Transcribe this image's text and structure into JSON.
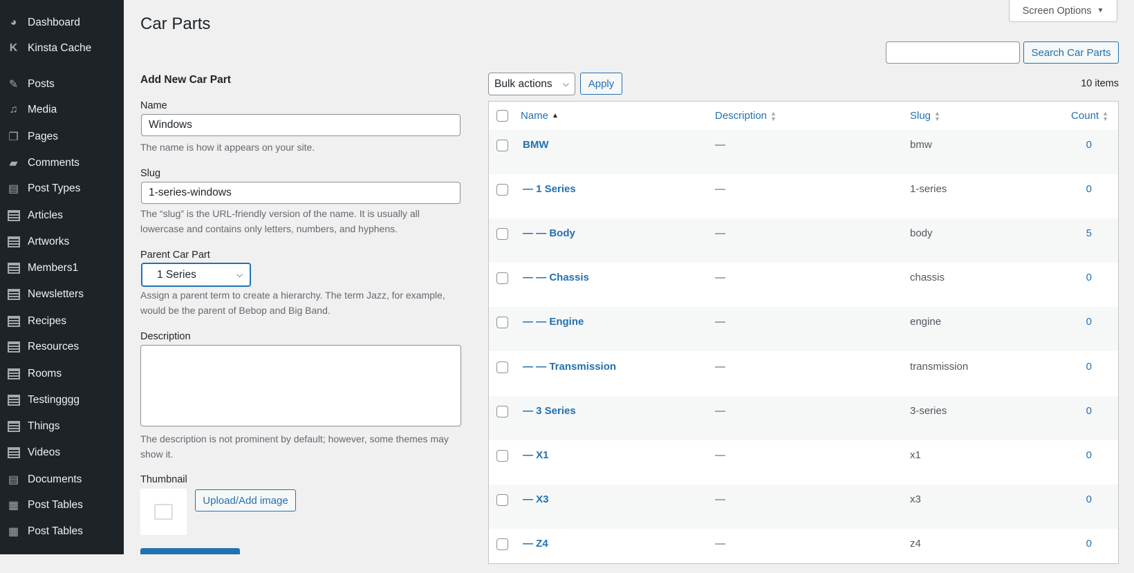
{
  "sidebar": {
    "items": [
      {
        "label": "Dashboard",
        "icon": "dashboard-icon"
      },
      {
        "label": "Kinsta Cache",
        "icon": "kinsta-icon"
      },
      {
        "label": "Posts",
        "icon": "pin-icon"
      },
      {
        "label": "Media",
        "icon": "media-icon"
      },
      {
        "label": "Pages",
        "icon": "pages-icon"
      },
      {
        "label": "Comments",
        "icon": "comment-icon"
      },
      {
        "label": "Post Types",
        "icon": "post-types-icon"
      },
      {
        "label": "Articles",
        "icon": "table-icon"
      },
      {
        "label": "Artworks",
        "icon": "table-icon"
      },
      {
        "label": "Members1",
        "icon": "table-icon"
      },
      {
        "label": "Newsletters",
        "icon": "table-icon"
      },
      {
        "label": "Recipes",
        "icon": "table-icon"
      },
      {
        "label": "Resources",
        "icon": "table-icon"
      },
      {
        "label": "Rooms",
        "icon": "table-icon"
      },
      {
        "label": "Testingggg",
        "icon": "table-icon"
      },
      {
        "label": "Things",
        "icon": "table-icon"
      },
      {
        "label": "Videos",
        "icon": "table-icon"
      },
      {
        "label": "Documents",
        "icon": "document-icon"
      },
      {
        "label": "Post Tables",
        "icon": "grid-icon"
      },
      {
        "label": "Post Tables",
        "icon": "grid-icon"
      }
    ]
  },
  "header": {
    "title": "Car Parts",
    "screen_options": "Screen Options",
    "search_placeholder": "",
    "search_button": "Search Car Parts"
  },
  "form": {
    "heading": "Add New Car Part",
    "name_label": "Name",
    "name_value": "Windows",
    "name_help": "The name is how it appears on your site.",
    "slug_label": "Slug",
    "slug_value": "1-series-windows",
    "slug_help": "The “slug” is the URL-friendly version of the name. It is usually all lowercase and contains only letters, numbers, and hyphens.",
    "parent_label": "Parent Car Part",
    "parent_value": "1 Series",
    "parent_help": "Assign a parent term to create a hierarchy. The term Jazz, for example, would be the parent of Bebop and Big Band.",
    "desc_label": "Description",
    "desc_value": "",
    "desc_help": "The description is not prominent by default; however, some themes may show it.",
    "thumb_label": "Thumbnail",
    "upload_button": "Upload/Add image"
  },
  "table": {
    "bulk_actions": "Bulk actions",
    "apply": "Apply",
    "items_count": "10 items",
    "columns": [
      "Name",
      "Description",
      "Slug",
      "Count"
    ],
    "rows": [
      {
        "name": "BMW",
        "description": "—",
        "slug": "bmw",
        "count": "0"
      },
      {
        "name": "— 1 Series",
        "description": "—",
        "slug": "1-series",
        "count": "0"
      },
      {
        "name": "— — Body",
        "description": "—",
        "slug": "body",
        "count": "5"
      },
      {
        "name": "— — Chassis",
        "description": "—",
        "slug": "chassis",
        "count": "0"
      },
      {
        "name": "— — Engine",
        "description": "—",
        "slug": "engine",
        "count": "0"
      },
      {
        "name": "— — Transmission",
        "description": "—",
        "slug": "transmission",
        "count": "0"
      },
      {
        "name": "— 3 Series",
        "description": "—",
        "slug": "3-series",
        "count": "0"
      },
      {
        "name": "— X1",
        "description": "—",
        "slug": "x1",
        "count": "0"
      },
      {
        "name": "— X3",
        "description": "—",
        "slug": "x3",
        "count": "0"
      },
      {
        "name": "— Z4",
        "description": "—",
        "slug": "z4",
        "count": "0"
      }
    ]
  }
}
